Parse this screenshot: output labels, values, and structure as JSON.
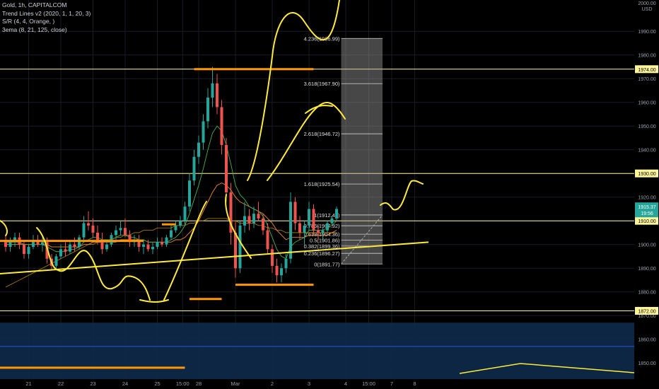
{
  "symbol": {
    "title": "Gold, 1h, CAPITALCOM",
    "indicators": [
      "Trend Lines v2 (2020, 1, 1, 20, 3)",
      "S/R (4, 4, Orange, )",
      "3ema (8, 21, 125, close)"
    ]
  },
  "price_axis": {
    "currency": "USD",
    "top_label": "2000.00",
    "ticks": [
      "1990.00",
      "1980.00",
      "1970.00",
      "1960.00",
      "1950.00",
      "1940.00",
      "1930.00",
      "1920.00",
      "1910.00",
      "1900.00",
      "1890.00",
      "1880.00",
      "1870.00",
      "1860.00",
      "1850.00"
    ],
    "levels": [
      {
        "value": 1974,
        "label": "1974.00"
      },
      {
        "value": 1930,
        "label": "1930.00"
      },
      {
        "value": 1910,
        "label": "1910.00"
      },
      {
        "value": 1872,
        "label": "1872.00"
      }
    ],
    "last_price": {
      "value": 1915.37,
      "label": "1915.37",
      "countdown": "19:56",
      "color": "#26a69a"
    }
  },
  "time_axis": {
    "labels": [
      "21",
      "22",
      "23",
      "24",
      "25",
      "15:00",
      "28",
      "Mar",
      "2",
      "3",
      "4",
      "15:00",
      "7",
      "8"
    ]
  },
  "fib_labels": [
    "4.236(1986.99)",
    "3.618(1967.90)",
    "2.618(1946.72)",
    "1.618(1925.54)",
    "1(1912.46)",
    "0.786(1907.92)",
    "0.618(1904.36)",
    "0.5(1901.86)",
    "0.382(1899.36)",
    "0.236(1896.27)",
    "0(1891.77)"
  ],
  "colors": {
    "up": "#26a69a",
    "down": "#ef5350",
    "level": "#fff59d",
    "orange": "#ff9800",
    "sketch": "#ffeb3b",
    "zone": "#0d2a4a",
    "grid": "#1a1c22"
  },
  "chart_data": {
    "type": "candlestick",
    "ylim": [
      1842,
      2002
    ],
    "candles": [
      [
        1902,
        1904,
        1897,
        1899
      ],
      [
        1899,
        1903,
        1897,
        1901
      ],
      [
        1901,
        1905,
        1899,
        1903
      ],
      [
        1903,
        1905,
        1898,
        1900
      ],
      [
        1900,
        1902,
        1894,
        1896
      ],
      [
        1896,
        1900,
        1894,
        1899
      ],
      [
        1899,
        1904,
        1898,
        1902
      ],
      [
        1902,
        1904,
        1899,
        1900
      ],
      [
        1900,
        1903,
        1897,
        1901
      ],
      [
        1901,
        1903,
        1892,
        1894
      ],
      [
        1894,
        1896,
        1889,
        1891
      ],
      [
        1891,
        1896,
        1890,
        1895
      ],
      [
        1895,
        1900,
        1894,
        1898
      ],
      [
        1898,
        1901,
        1895,
        1897
      ],
      [
        1897,
        1902,
        1896,
        1900
      ],
      [
        1900,
        1903,
        1897,
        1899
      ],
      [
        1899,
        1904,
        1898,
        1903
      ],
      [
        1903,
        1912,
        1902,
        1909
      ],
      [
        1909,
        1914,
        1906,
        1908
      ],
      [
        1908,
        1911,
        1903,
        1905
      ],
      [
        1905,
        1908,
        1900,
        1902
      ],
      [
        1902,
        1905,
        1896,
        1898
      ],
      [
        1898,
        1902,
        1897,
        1900
      ],
      [
        1900,
        1905,
        1899,
        1904
      ],
      [
        1904,
        1908,
        1902,
        1906
      ],
      [
        1906,
        1910,
        1904,
        1907
      ],
      [
        1907,
        1911,
        1903,
        1904
      ],
      [
        1904,
        1906,
        1899,
        1901
      ],
      [
        1901,
        1904,
        1899,
        1902
      ],
      [
        1902,
        1904,
        1897,
        1899
      ],
      [
        1899,
        1902,
        1896,
        1900
      ],
      [
        1900,
        1902,
        1897,
        1898
      ],
      [
        1898,
        1901,
        1896,
        1899
      ],
      [
        1899,
        1903,
        1898,
        1901
      ],
      [
        1901,
        1903,
        1899,
        1900
      ],
      [
        1900,
        1904,
        1899,
        1903
      ],
      [
        1903,
        1908,
        1902,
        1906
      ],
      [
        1906,
        1910,
        1905,
        1908
      ],
      [
        1908,
        1912,
        1907,
        1910
      ],
      [
        1910,
        1918,
        1908,
        1916
      ],
      [
        1916,
        1930,
        1914,
        1927
      ],
      [
        1927,
        1940,
        1925,
        1937
      ],
      [
        1937,
        1946,
        1934,
        1943
      ],
      [
        1943,
        1955,
        1940,
        1952
      ],
      [
        1952,
        1966,
        1949,
        1962
      ],
      [
        1962,
        1975,
        1958,
        1968
      ],
      [
        1968,
        1972,
        1955,
        1958
      ],
      [
        1958,
        1961,
        1938,
        1942
      ],
      [
        1942,
        1945,
        1918,
        1922
      ],
      [
        1922,
        1926,
        1900,
        1905
      ],
      [
        1905,
        1910,
        1886,
        1890
      ],
      [
        1890,
        1910,
        1888,
        1908
      ],
      [
        1908,
        1918,
        1905,
        1912
      ],
      [
        1912,
        1915,
        1906,
        1909
      ],
      [
        1909,
        1916,
        1907,
        1913
      ],
      [
        1913,
        1918,
        1910,
        1911
      ],
      [
        1911,
        1913,
        1904,
        1906
      ],
      [
        1906,
        1909,
        1896,
        1898
      ],
      [
        1898,
        1900,
        1888,
        1891
      ],
      [
        1891,
        1894,
        1884,
        1887
      ],
      [
        1887,
        1892,
        1884,
        1890
      ],
      [
        1890,
        1896,
        1888,
        1894
      ],
      [
        1894,
        1922,
        1892,
        1918
      ],
      [
        1918,
        1920,
        1906,
        1909
      ],
      [
        1909,
        1912,
        1902,
        1905
      ],
      [
        1905,
        1910,
        1900,
        1908
      ],
      [
        1908,
        1918,
        1906,
        1915
      ],
      [
        1915,
        1917,
        1904,
        1906
      ],
      [
        1906,
        1908,
        1902,
        1905
      ],
      [
        1905,
        1907,
        1902,
        1906
      ],
      [
        1906,
        1910,
        1905,
        1909
      ],
      [
        1909,
        1912,
        1908,
        1911
      ],
      [
        1911,
        1916,
        1910,
        1915
      ]
    ],
    "ema_fast": [
      1901,
      1901,
      1901,
      1901,
      1900,
      1900,
      1900,
      1900,
      1900,
      1899,
      1898,
      1897,
      1897,
      1897,
      1898,
      1898,
      1899,
      1901,
      1902,
      1903,
      1903,
      1902,
      1902,
      1902,
      1903,
      1904,
      1904,
      1903,
      1903,
      1902,
      1902,
      1901,
      1901,
      1901,
      1901,
      1901,
      1902,
      1903,
      1905,
      1908,
      1913,
      1919,
      1925,
      1932,
      1940,
      1947,
      1950,
      1948,
      1942,
      1934,
      1925,
      1921,
      1919,
      1916,
      1915,
      1914,
      1912,
      1908,
      1903,
      1898,
      1895,
      1894,
      1899,
      1901,
      1902,
      1903,
      1906,
      1906,
      1906,
      1906,
      1907,
      1908,
      1910
    ],
    "ema_slow": [
      1900,
      1900,
      1900,
      1900,
      1900,
      1900,
      1900,
      1900,
      1900,
      1900,
      1899,
      1899,
      1899,
      1899,
      1899,
      1899,
      1899,
      1900,
      1900,
      1901,
      1901,
      1901,
      1901,
      1901,
      1901,
      1902,
      1902,
      1902,
      1902,
      1902,
      1902,
      1901,
      1901,
      1901,
      1901,
      1901,
      1901,
      1902,
      1902,
      1903,
      1905,
      1907,
      1910,
      1914,
      1918,
      1922,
      1925,
      1926,
      1925,
      1923,
      1920,
      1918,
      1917,
      1916,
      1915,
      1914,
      1913,
      1911,
      1909,
      1906,
      1904,
      1902,
      1903,
      1903,
      1903,
      1903,
      1904,
      1904,
      1904,
      1904,
      1904,
      1905,
      1906
    ],
    "ema_long": [
      1882,
      1883,
      1884,
      1885,
      1886,
      1887,
      1888,
      1889,
      1890,
      1891,
      1892,
      1893,
      1894,
      1895,
      1896,
      1897,
      1898,
      1899,
      1900,
      1900,
      1901,
      1901,
      1902,
      1902,
      1903,
      1903,
      1904,
      1904,
      1905,
      1905,
      1906,
      1906,
      1906,
      1907,
      1907,
      1907,
      1907,
      1908,
      1908,
      1908,
      1909,
      1909,
      1910,
      1910,
      1911,
      1911,
      1911,
      1911,
      1911,
      1910,
      1910,
      1909,
      1909,
      1909,
      1909,
      1908,
      1908,
      1907,
      1907,
      1906,
      1906,
      1905,
      1905,
      1905,
      1905,
      1905,
      1905,
      1905,
      1905,
      1905,
      1905,
      1905,
      1905
    ],
    "fib_levels": [
      1986.99,
      1967.9,
      1946.72,
      1925.54,
      1912.46,
      1907.92,
      1904.36,
      1901.86,
      1899.36,
      1896.27,
      1891.77
    ],
    "time_label_index": [
      5,
      12,
      19,
      26,
      33,
      38.5,
      42,
      50,
      58,
      66,
      74,
      79,
      84,
      89
    ],
    "orange_lines": [
      [
        -6,
        1901.5,
        30,
        1901.5
      ],
      [
        34,
        1908.5,
        37,
        1908.5
      ],
      [
        41,
        1974,
        67,
        1974
      ],
      [
        40,
        1877,
        47,
        1877
      ],
      [
        50,
        1883,
        67,
        1883
      ],
      [
        -6,
        1848,
        39,
        1848
      ]
    ],
    "trend_line": [
      [
        -6,
        1887
      ],
      [
        92,
        1901
      ]
    ],
    "zone": [
      1843,
      1867
    ]
  }
}
